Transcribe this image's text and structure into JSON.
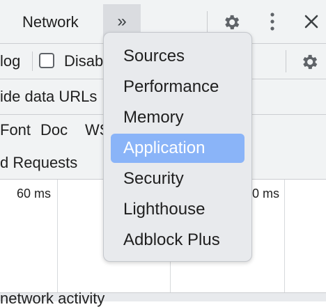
{
  "tabs": {
    "network_label": "Network",
    "more_tabs_symbol": "»"
  },
  "toolbar": {
    "preserve_log_partial": "log",
    "disable_cache_partial": "Disab"
  },
  "filters": {
    "hide_data_urls_partial": "ide data URLs",
    "type_font": "Font",
    "type_doc": "Doc",
    "type_ws_partial": "WS",
    "blocked_requests_partial": "d Requests"
  },
  "timeline": {
    "label_60": "60 ms",
    "label_partial": "0 ms"
  },
  "status": {
    "network_activity_partial": "network activity"
  },
  "menu": {
    "items": [
      {
        "label": "Sources"
      },
      {
        "label": "Performance"
      },
      {
        "label": "Memory"
      },
      {
        "label": "Application"
      },
      {
        "label": "Security"
      },
      {
        "label": "Lighthouse"
      },
      {
        "label": "Adblock Plus"
      }
    ],
    "selected_index": 3
  },
  "colors": {
    "selected_bg": "#8ab4f8",
    "toolbar_bg": "#f1f3f4",
    "menu_bg": "#e8eaed"
  },
  "icons": [
    "gear-icon",
    "kebab-menu-icon",
    "close-icon",
    "chevron-double-right-icon"
  ]
}
